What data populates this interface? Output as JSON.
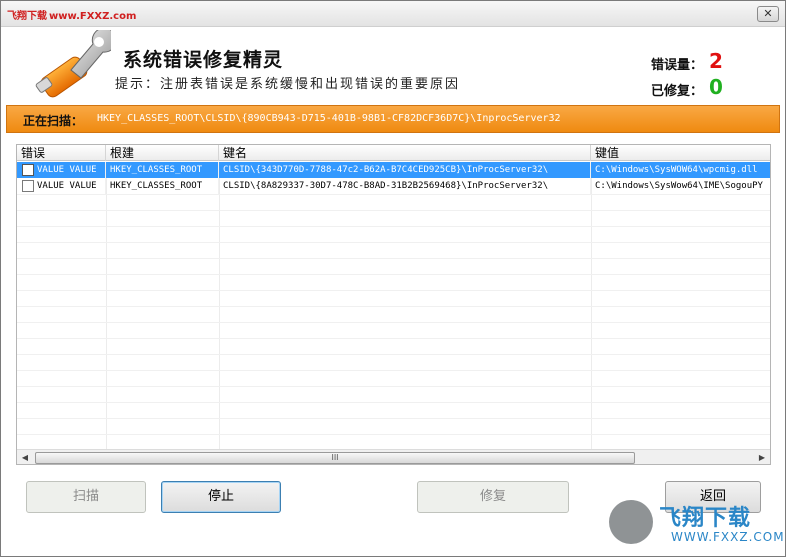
{
  "window": {
    "title_brand": "飞翔下载",
    "title_url": "www.FXXZ.com",
    "close_icon": "close-icon"
  },
  "header": {
    "logo_icon": "wrench-usb-icon",
    "app_title": "系统错误修复精灵",
    "hint": "提示：注册表错误是系统缓慢和出现错误的重要原因",
    "errors_label": "错误量：",
    "errors_value": "2",
    "fixed_label": "已修复：",
    "fixed_value": "0",
    "errors_color": "#e01010",
    "fixed_color": "#20b020"
  },
  "scan": {
    "label": "正在扫描：",
    "path": "HKEY_CLASSES_ROOT\\CLSID\\{890CB943-D715-401B-98B1-CF82DCF36D7C}\\InprocServer32"
  },
  "list": {
    "columns": [
      "错误",
      "根建",
      "键名",
      "键值"
    ],
    "rows": [
      {
        "checked": false,
        "selected": true,
        "error": "VALUE VALUE",
        "root": "HKEY_CLASSES_ROOT",
        "key": "CLSID\\{343D770D-7788-47c2-B62A-B7C4CED925CB}\\InProcServer32\\",
        "value": "C:\\Windows\\SysWOW64\\wpcmig.dll"
      },
      {
        "checked": false,
        "selected": false,
        "error": "VALUE VALUE",
        "root": "HKEY_CLASSES_ROOT",
        "key": "CLSID\\{8A829337-30D7-478C-B8AD-31B2B2569468}\\InProcServer32\\",
        "value": "C:\\Windows\\SysWow64\\IME\\SogouPY"
      }
    ],
    "scroll_left_icon": "scroll-left-icon",
    "scroll_right_icon": "scroll-right-icon",
    "scroll_grip": "III"
  },
  "buttons": {
    "scan": "扫描",
    "stop": "停止",
    "repair": "修复",
    "back": "返回"
  },
  "watermark": {
    "text": "飞翔下载",
    "sub": "WWW.FXXZ.COM"
  }
}
